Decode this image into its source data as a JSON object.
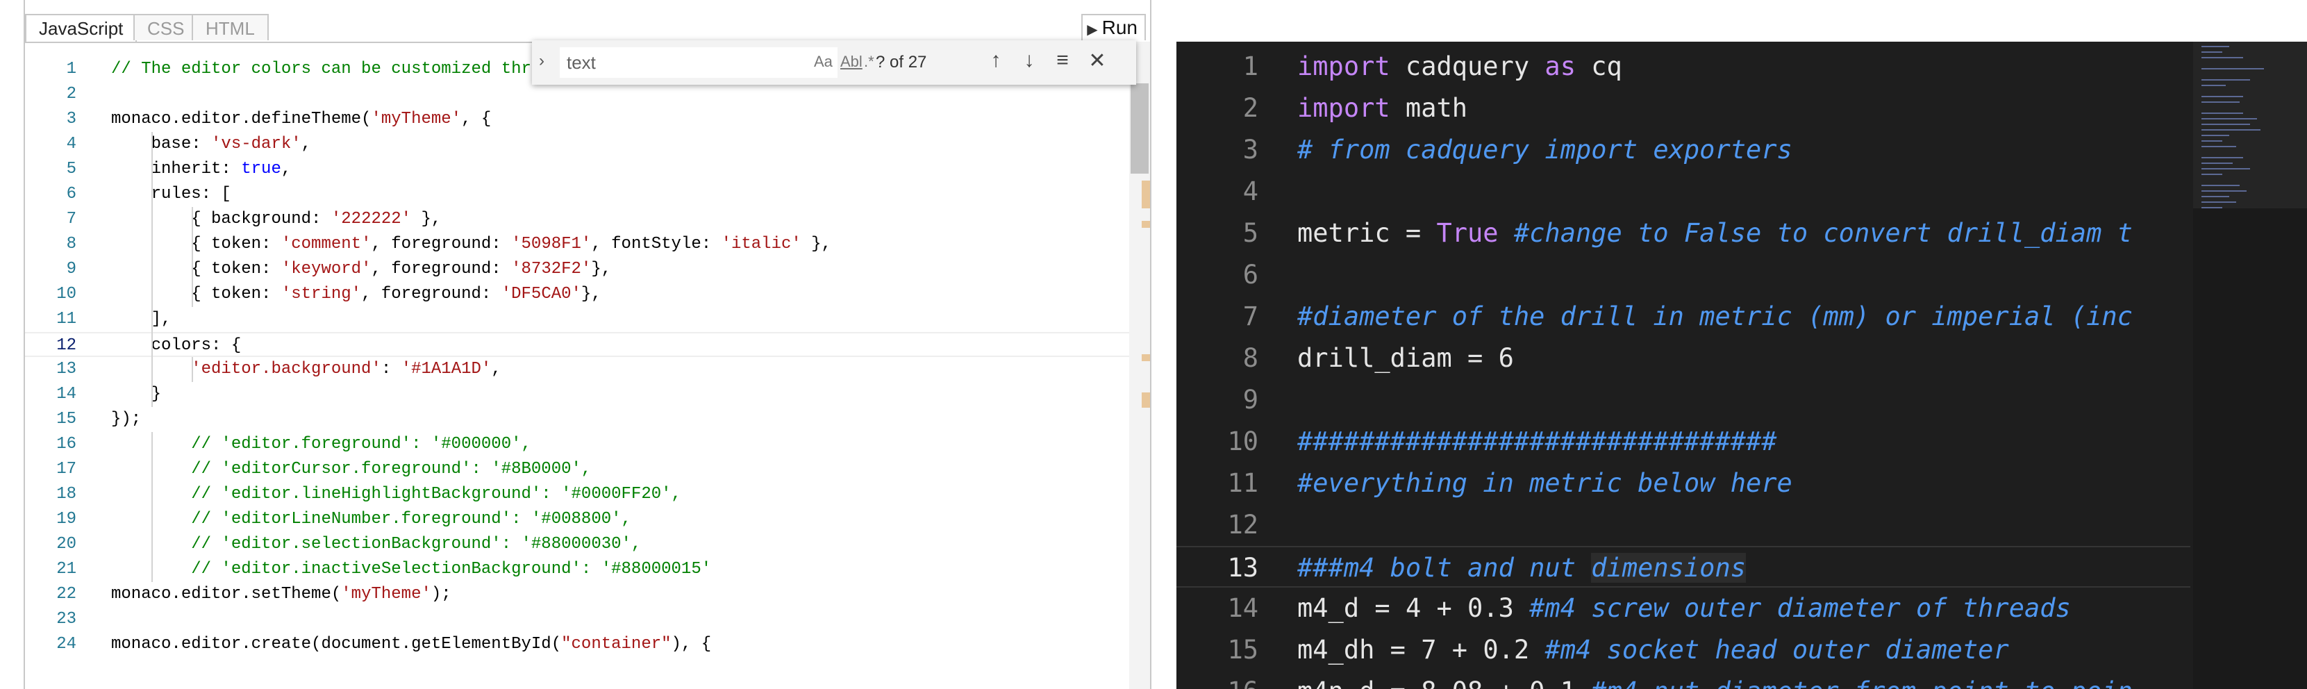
{
  "left_editor": {
    "tabs": [
      {
        "label": "JavaScript",
        "active": true
      },
      {
        "label": "CSS",
        "active": false
      },
      {
        "label": "HTML",
        "active": false
      }
    ],
    "run_label": "Run",
    "run_icon": "play-icon",
    "current_line": 12,
    "find": {
      "value": "text",
      "count": "? of 27",
      "match_case_label": "Aa",
      "whole_word_label": "Abl",
      "regex_label": ".*"
    },
    "lines": [
      [
        [
          "comment",
          "// The editor colors can be customized through CSS or through JS"
        ]
      ],
      [],
      [
        [
          "plain",
          "monaco.editor.defineTheme("
        ],
        [
          "string",
          "'myTheme'"
        ],
        [
          "plain",
          ", {"
        ]
      ],
      [
        [
          "plain",
          "    base: "
        ],
        [
          "string",
          "'vs-dark'"
        ],
        [
          "plain",
          ","
        ]
      ],
      [
        [
          "plain",
          "    inherit: "
        ],
        [
          "keyword",
          "true"
        ],
        [
          "plain",
          ","
        ]
      ],
      [
        [
          "plain",
          "    rules: ["
        ]
      ],
      [
        [
          "plain",
          "        { background: "
        ],
        [
          "string",
          "'222222'"
        ],
        [
          "plain",
          " },"
        ]
      ],
      [
        [
          "plain",
          "        { token: "
        ],
        [
          "string",
          "'comment'"
        ],
        [
          "plain",
          ", foreground: "
        ],
        [
          "string",
          "'5098F1'"
        ],
        [
          "plain",
          ", fontStyle: "
        ],
        [
          "string",
          "'italic'"
        ],
        [
          "plain",
          " },"
        ]
      ],
      [
        [
          "plain",
          "        { token: "
        ],
        [
          "string",
          "'keyword'"
        ],
        [
          "plain",
          ", foreground: "
        ],
        [
          "string",
          "'8732F2'"
        ],
        [
          "plain",
          "},"
        ]
      ],
      [
        [
          "plain",
          "        { token: "
        ],
        [
          "string",
          "'string'"
        ],
        [
          "plain",
          ", foreground: "
        ],
        [
          "string",
          "'DF5CA0'"
        ],
        [
          "plain",
          "},"
        ]
      ],
      [
        [
          "plain",
          "    ],"
        ]
      ],
      [
        [
          "plain",
          "    colors: {"
        ]
      ],
      [
        [
          "plain",
          "        "
        ],
        [
          "string",
          "'editor.background'"
        ],
        [
          "plain",
          ": "
        ],
        [
          "string",
          "'#1A1A1D'"
        ],
        [
          "plain",
          ","
        ]
      ],
      [
        [
          "plain",
          "    }"
        ]
      ],
      [
        [
          "plain",
          "});"
        ]
      ],
      [
        [
          "comment",
          "        // 'editor.foreground': '#000000',"
        ]
      ],
      [
        [
          "comment",
          "        // 'editorCursor.foreground': '#8B0000',"
        ]
      ],
      [
        [
          "comment",
          "        // 'editor.lineHighlightBackground': '#0000FF20',"
        ]
      ],
      [
        [
          "comment",
          "        // 'editorLineNumber.foreground': '#008800',"
        ]
      ],
      [
        [
          "comment",
          "        // 'editor.selectionBackground': '#88000030',"
        ]
      ],
      [
        [
          "comment",
          "        // 'editor.inactiveSelectionBackground': '#88000015'"
        ]
      ],
      [
        [
          "plain",
          "monaco.editor.setTheme("
        ],
        [
          "string",
          "'myTheme'"
        ],
        [
          "plain",
          ");"
        ]
      ],
      [],
      [
        [
          "plain",
          "monaco.editor.create(document.getElementById("
        ],
        [
          "string",
          "\"container\""
        ],
        [
          "plain",
          "), {"
        ]
      ]
    ]
  },
  "right_editor": {
    "current_line": 13,
    "lines": [
      [
        [
          "kw",
          "import"
        ],
        [
          "plain",
          " cadquery "
        ],
        [
          "kw",
          "as"
        ],
        [
          "plain",
          " cq"
        ]
      ],
      [
        [
          "kw",
          "import"
        ],
        [
          "plain",
          " math"
        ]
      ],
      [
        [
          "cm",
          "# from cadquery import exporters"
        ]
      ],
      [],
      [
        [
          "plain",
          "metric = "
        ],
        [
          "tr",
          "True"
        ],
        [
          "plain",
          " "
        ],
        [
          "cm",
          "#change to False to convert drill_diam t"
        ]
      ],
      [],
      [
        [
          "cm",
          "#diameter of the drill in metric (mm) or imperial (inc"
        ]
      ],
      [
        [
          "plain",
          "drill_diam = "
        ],
        [
          "num",
          "6"
        ]
      ],
      [],
      [
        [
          "cm",
          "###############################"
        ]
      ],
      [
        [
          "cm",
          "#everything in metric below here"
        ]
      ],
      [],
      [
        [
          "cm",
          "###m4 bolt and nut "
        ],
        [
          "cmhl",
          "dimensions"
        ]
      ],
      [
        [
          "plain",
          "m4_d = "
        ],
        [
          "num",
          "4"
        ],
        [
          "plain",
          " + "
        ],
        [
          "num",
          "0.3"
        ],
        [
          "plain",
          " "
        ],
        [
          "cm",
          "#m4 screw outer diameter of threads"
        ]
      ],
      [
        [
          "plain",
          "m4_dh = "
        ],
        [
          "num",
          "7"
        ],
        [
          "plain",
          " + "
        ],
        [
          "num",
          "0.2"
        ],
        [
          "plain",
          " "
        ],
        [
          "cm",
          "#m4 socket head outer diameter"
        ]
      ],
      [
        [
          "plain",
          "m4n_d = "
        ],
        [
          "num",
          "8.08"
        ],
        [
          "plain",
          " + "
        ],
        [
          "num",
          "0.1"
        ],
        [
          "plain",
          " "
        ],
        [
          "cm",
          "#m4 nut diameter from point to poin"
        ]
      ]
    ]
  }
}
